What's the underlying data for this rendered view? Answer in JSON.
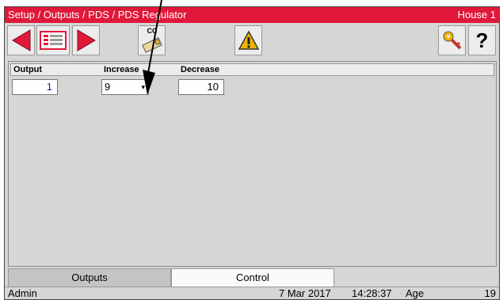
{
  "titlebar": {
    "breadcrumb": "Setup / Outputs / PDS / PDS Regulator",
    "location": "House 1"
  },
  "toolbar": {
    "cc_label": "CC"
  },
  "table": {
    "headers": [
      "Output",
      "Increase",
      "Decrease"
    ],
    "rows": [
      {
        "output": "1",
        "increase": "9",
        "decrease": "10"
      }
    ]
  },
  "tabs": [
    {
      "label": "Outputs",
      "active": true
    },
    {
      "label": "Control",
      "active": false
    }
  ],
  "status": {
    "user": "Admin",
    "date": "7 Mar 2017",
    "time": "14:28:37",
    "age_label": "Age",
    "age_value": "19"
  },
  "colors": {
    "titlebar": "#e0193a",
    "arrow_red": "#e0193a",
    "warning": "#f2b600",
    "cell_value": "#1a2a8a"
  },
  "icons": [
    "arrow-left-icon",
    "report-icon",
    "arrow-right-icon",
    "cc-key-icon",
    "warning-icon",
    "key-icon",
    "help-icon"
  ]
}
